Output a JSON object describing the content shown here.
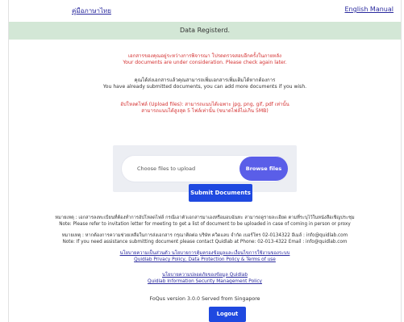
{
  "header": {
    "thai_manual_link": "คู่มือภาษาไทย",
    "english_manual_link": "English Manual"
  },
  "banner": {
    "title": "Data Registerd."
  },
  "consideration": {
    "thai": "เอกสารของคุณอยู่ระหว่างการพิจารณา โปรดตรวจสอบอีกครั้งในภายหลัง",
    "english": "Your documents are under consideration. Please check again later."
  },
  "submitted": {
    "thai": "คุณได้ส่งเอกสารแล้วคุณสามารถเพิ่มเอกสารเพิ่มเติมได้หากต้องการ",
    "english": "You have already submitted documents, you can add more documents if you wish."
  },
  "upload_rules": {
    "line1": "อัปโหลดไฟล์ (Upload files): สามารถแนบได้เฉพาะ jpg, png, gif, pdf เท่านั้น",
    "line2": "สามารถแนบได้สูงสุด 5 ไฟล์เท่านั้น (ขนาดไฟล์ไม่เกิน 5MB)"
  },
  "upload": {
    "placeholder": "Choose files to upload",
    "browse_label": "Browse files"
  },
  "submit_label": "Submit Documents",
  "notes": {
    "remark_thai": "หมายเหตุ : เอกสารลงทะเบียนที่ต้องทำการอัปโหลดไฟล์ กรณีเอาตัวเอกสารมาเองหรือมอบฉันทะ สามารถดูรายละเอียด ตามที่ระบุไว้ในหนังสือเชิญประชุม",
    "remark_english": "Note: Please refer to invitation letter for meeting to get a list of document to be uploaded in case of coming in person or proxy",
    "assist_thai": "หมายเหตุ : หากต้องการความช่วยเหลือในการส่งเอกสาร กรุณาติดต่อ บริษัท ควิดแลบ จำกัด เบอร์โทร 02-0134322 อีเมล์ : info@quidlab.com",
    "assist_english": "Note: If you need assistance submitting document please contact Quidlab at Phone: 02-013-4322 Email : info@quidlab.com"
  },
  "links": {
    "privacy_thai": "นโยบายความเป็นส่วนตัว นโยบายการคุ้มครองข้อมูลและเงื่อนไขการใช้งานของระบบ",
    "privacy_english": "Quidlab Privacy Policy, Data Protection Policy & Terms of use",
    "security_thai": "นโยบายความปลอดภัยของข้อมูล Quidlab",
    "security_english": "Quidlab Information Security Management Policy"
  },
  "footer": {
    "version": "FoQus version 3.0.0 Served from Singapore",
    "logout_label": "Logout"
  },
  "colors": {
    "banner_bg": "#d3e7d6",
    "accent_red": "#d43030",
    "primary_blue": "#1f49e0",
    "browse_purple": "#5a5ee8",
    "link_blue": "#2a2a9e"
  }
}
